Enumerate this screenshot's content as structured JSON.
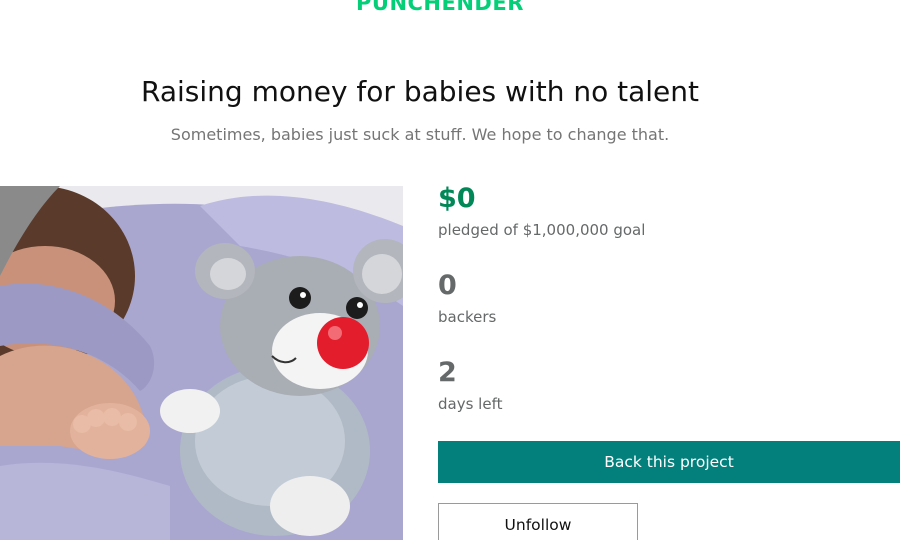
{
  "header": {
    "logo_text": "PUNCHENDER"
  },
  "project": {
    "title": "Raising money for babies with no talent",
    "subtitle": "Sometimes, babies just suck at stuff. We hope to change that.",
    "image_subject": "baby-sleeping-with-plush-mouse-image"
  },
  "stats": {
    "pledged_amount": "$0",
    "pledged_label": "pledged of $1,000,000 goal",
    "backers_count": "0",
    "backers_label": "backers",
    "days_left_count": "2",
    "days_left_label": "days left"
  },
  "actions": {
    "back_label": "Back this project",
    "unfollow_label": "Unfollow"
  },
  "colors": {
    "brand": "#05ce78",
    "pledged": "#028858",
    "primary_button": "#037f7c",
    "muted_text": "#656969"
  }
}
